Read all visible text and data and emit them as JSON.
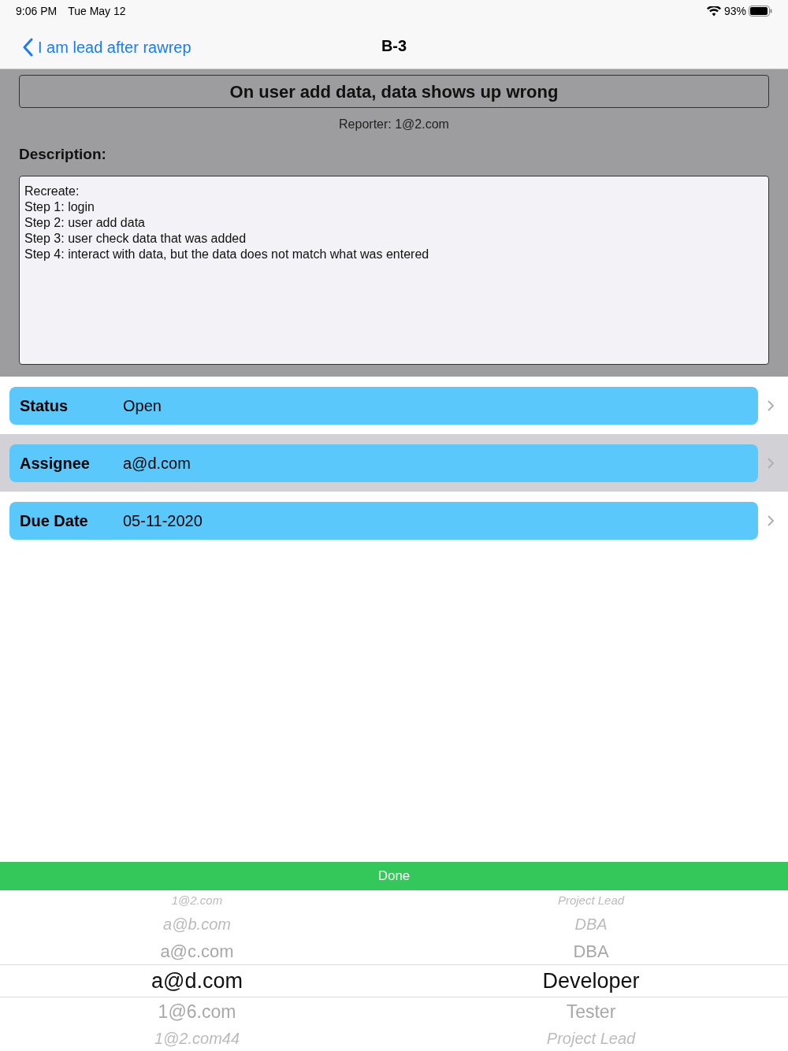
{
  "status_bar": {
    "time": "9:06 PM",
    "date": "Tue May 12",
    "battery": "93%"
  },
  "nav": {
    "back": "I am lead after rawrep",
    "title": "B-3"
  },
  "issue": {
    "title": "On user add data, data shows up wrong",
    "reporter": "Reporter: 1@2.com",
    "description_label": "Description:",
    "description": "Recreate:\nStep 1: login\nStep 2: user add data\nStep 3: user check data that was added\nStep 4: interact with data, but the data does not match what was entered"
  },
  "fields": [
    {
      "label": "Status",
      "value": "Open",
      "selected": false
    },
    {
      "label": "Assignee",
      "value": "a@d.com",
      "selected": true
    },
    {
      "label": "Due Date",
      "value": "05-11-2020",
      "selected": false
    }
  ],
  "done_button": "Done",
  "picker": [
    {
      "email": "1@2.com",
      "role": "Project Lead",
      "selected": false
    },
    {
      "email": "a@b.com",
      "role": "DBA",
      "selected": false
    },
    {
      "email": "a@c.com",
      "role": "DBA",
      "selected": false
    },
    {
      "email": "a@d.com",
      "role": "Developer",
      "selected": true
    },
    {
      "email": "1@6.com",
      "role": "Tester",
      "selected": false
    },
    {
      "email": "1@2.com44",
      "role": "Project Lead",
      "selected": false
    }
  ]
}
